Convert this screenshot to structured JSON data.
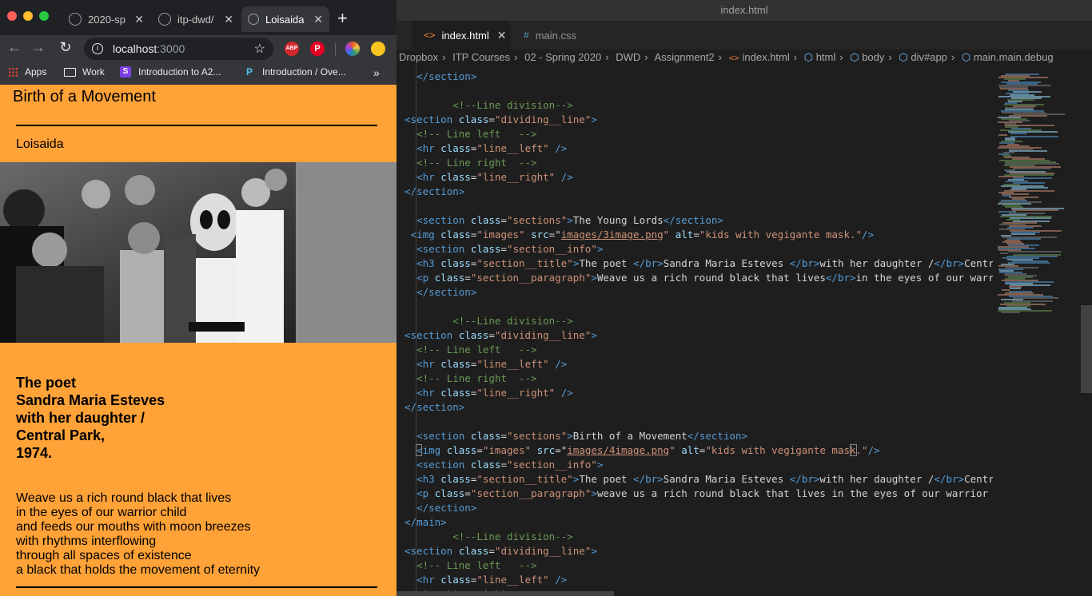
{
  "browser": {
    "tabs": [
      {
        "title": "2020-sp",
        "close": "✕"
      },
      {
        "title": "itp-dwd/",
        "close": "✕"
      },
      {
        "title": "Loisaida",
        "close": "✕"
      }
    ],
    "new_tab": "+",
    "url_host": "localhost",
    "url_port": ":3000",
    "extensions": {
      "abp": "ABP",
      "pinterest": "P"
    },
    "bookmarks": [
      {
        "label": "Apps"
      },
      {
        "label": "Work"
      },
      {
        "label": "Introduction to A2..."
      },
      {
        "label": "Introduction / Ove..."
      }
    ],
    "bookmarks_more": "»"
  },
  "page": {
    "heading": "Birth of a Movement",
    "subheading": "Loisaida",
    "poet_title_lines": [
      "The poet",
      "Sandra Maria Esteves",
      "with her daughter /",
      "Central Park,",
      "1974."
    ],
    "poem_lines": [
      "Weave us a rich round black that lives",
      "in the eyes of our warrior child",
      "and feeds our mouths with moon breezes",
      "with rhythms interflowing",
      "through all spaces of existence",
      "a black that holds the movement of eternity"
    ]
  },
  "editor": {
    "window_title": "index.html",
    "tabs": [
      {
        "icon": "<>",
        "label": "index.html",
        "close": "✕"
      },
      {
        "icon": "#",
        "label": "main.css"
      }
    ],
    "more": "···",
    "breadcrumb": [
      "Dropbox",
      "ITP Courses",
      "02 - Spring 2020",
      "DWD",
      "Assignment2",
      "index.html",
      "html",
      "body",
      "div#app",
      "main.main.debug"
    ],
    "colors": {
      "accent": "#ffa238",
      "tag": "#569cd6",
      "attr": "#9cdcfe",
      "string": "#ce9178",
      "comment": "#6a9955"
    }
  }
}
